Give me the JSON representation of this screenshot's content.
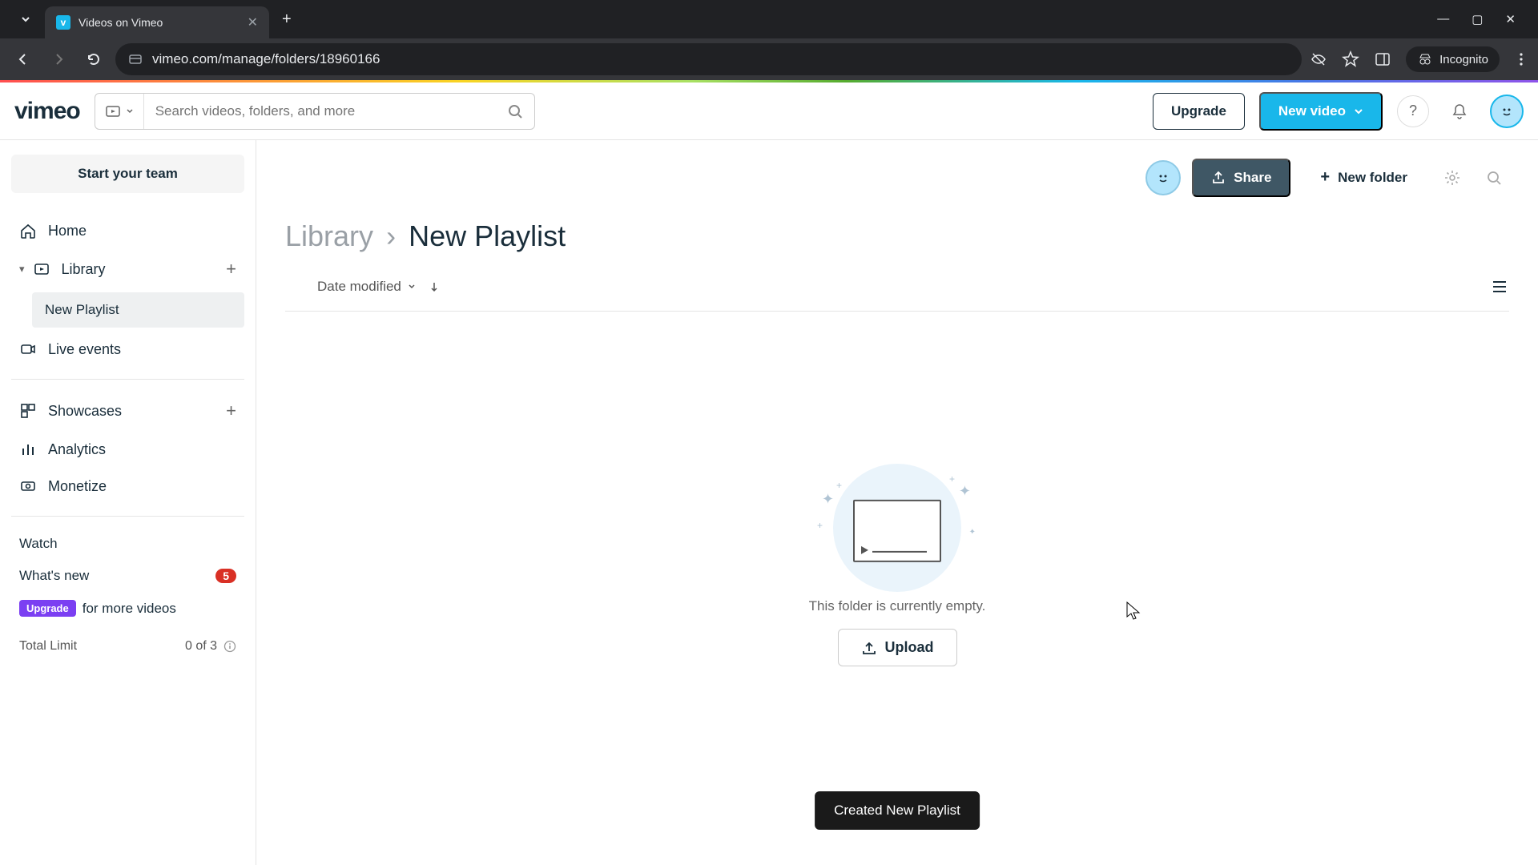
{
  "browser": {
    "tab_title": "Videos on Vimeo",
    "url": "vimeo.com/manage/folders/18960166",
    "incognito_label": "Incognito"
  },
  "header": {
    "logo_text": "vimeo",
    "search_placeholder": "Search videos, folders, and more",
    "upgrade_label": "Upgrade",
    "new_video_label": "New video"
  },
  "sidebar": {
    "start_team": "Start your team",
    "home": "Home",
    "library": "Library",
    "sub_new_playlist": "New Playlist",
    "live_events": "Live events",
    "showcases": "Showcases",
    "analytics": "Analytics",
    "monetize": "Monetize",
    "watch": "Watch",
    "whats_new": "What's new",
    "whats_new_count": "5",
    "upgrade_pill": "Upgrade",
    "upgrade_text": "for more videos",
    "total_limit_label": "Total Limit",
    "total_limit_value": "0 of 3"
  },
  "main": {
    "share_label": "Share",
    "new_folder_label": "New folder",
    "breadcrumb_root": "Library",
    "breadcrumb_current": "New Playlist",
    "sort_label": "Date modified",
    "empty_text": "This folder is currently empty.",
    "upload_label": "Upload",
    "toast": "Created New Playlist"
  }
}
